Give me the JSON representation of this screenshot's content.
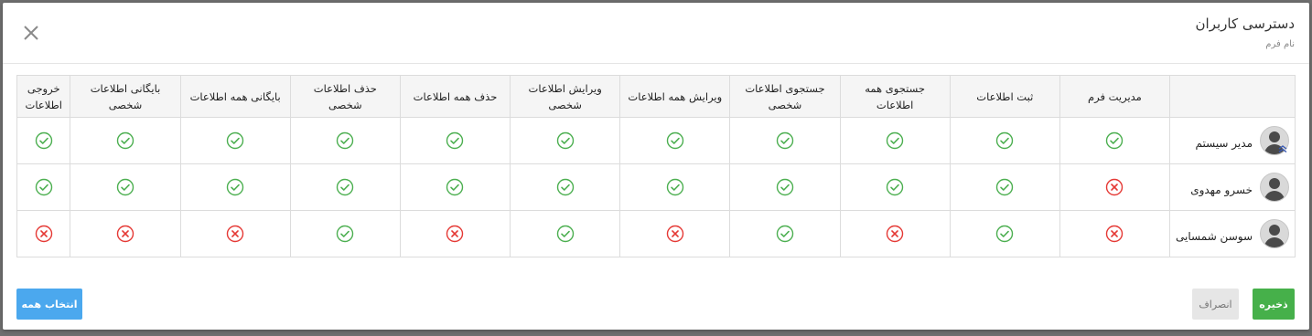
{
  "modal": {
    "title": "دسترسی کاربران",
    "subtitle": "نام فرم"
  },
  "table": {
    "columns": [
      "مدیریت فرم",
      "ثبت اطلاعات",
      "جستجوی همه اطلاعات",
      "جستجوی اطلاعات شخصی",
      "ویرایش همه اطلاعات",
      "ویرایش اطلاعات شخصی",
      "حذف همه اطلاعات",
      "حذف اطلاعات شخصی",
      "بایگانی همه اطلاعات",
      "بایگانی اطلاعات شخصی",
      "خروجی اطلاعات"
    ],
    "rows": [
      {
        "name": "مدیر سیستم",
        "perms": [
          true,
          true,
          true,
          true,
          true,
          true,
          true,
          true,
          true,
          true,
          true
        ]
      },
      {
        "name": "خسرو مهدوی",
        "perms": [
          false,
          true,
          true,
          true,
          true,
          true,
          true,
          true,
          true,
          true,
          true
        ]
      },
      {
        "name": "سوسن شمسایی",
        "perms": [
          false,
          true,
          false,
          true,
          false,
          true,
          false,
          true,
          false,
          false,
          false
        ]
      }
    ]
  },
  "buttons": {
    "save": "ذخیره",
    "cancel": "انصراف",
    "select_all": "انتخاب همه"
  },
  "colors": {
    "allowed": "#4caf50",
    "denied": "#e53935",
    "primary": "#4ba8ee",
    "success": "#46b04a"
  },
  "icons": {
    "close": "close-icon",
    "allowed": "check-circle-icon",
    "denied": "x-circle-icon",
    "avatar": "user-avatar-icon",
    "chevron": "chevron-up-icon"
  }
}
